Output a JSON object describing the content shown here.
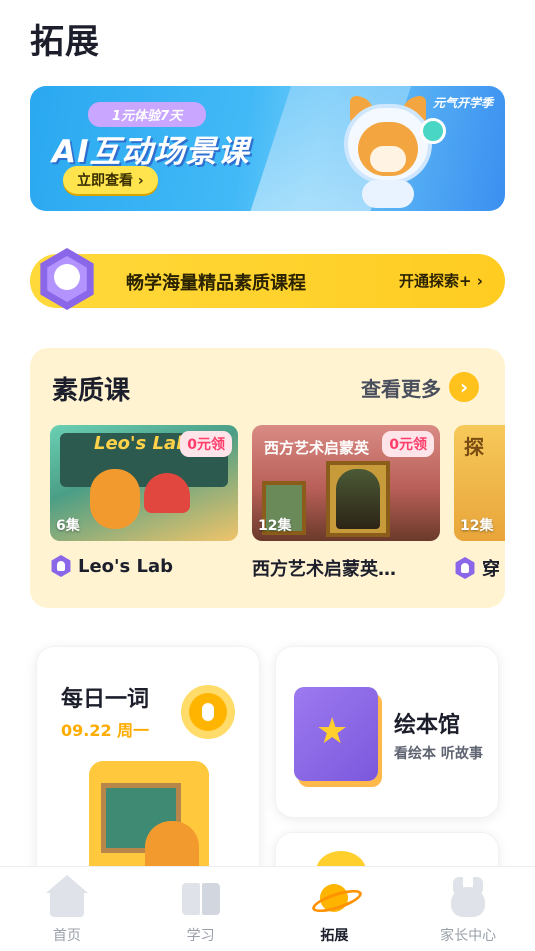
{
  "page": {
    "title": "拓展"
  },
  "banner": {
    "trial": "1元体验7天",
    "title": "AI互动场景课",
    "cta": "立即查看 ›",
    "badge": "元气开学季",
    "slides": 3,
    "active_slide": 1
  },
  "vip": {
    "text": "畅学海量精品素质课程",
    "action": "开通探索+ ›"
  },
  "quality": {
    "title": "素质课",
    "see_more": "查看更多",
    "see_more_arrow": "›",
    "courses": [
      {
        "name": "Leo's Lab",
        "episodes": "6集",
        "tag": "0元领",
        "thumb_text": "Leo's Lab"
      },
      {
        "name": "西方艺术启蒙英…",
        "episodes": "12集",
        "tag": "0元领",
        "thumb_text": "西方艺术启蒙英"
      },
      {
        "name": "穿",
        "episodes": "12集",
        "thumb_text": "探"
      }
    ]
  },
  "daily_word": {
    "title": "每日一词",
    "date": "09.22 周一"
  },
  "picture_book": {
    "title": "绘本馆",
    "subtitle": "看绘本 听故事",
    "star": "★"
  },
  "tabbar": {
    "tabs": [
      {
        "label": "首页",
        "icon": "home-icon"
      },
      {
        "label": "学习",
        "icon": "book-icon"
      },
      {
        "label": "拓展",
        "icon": "planet-icon",
        "active": true
      },
      {
        "label": "家长中心",
        "icon": "parent-icon"
      }
    ]
  },
  "colors": {
    "accent": "#ffc21c",
    "section_bg": "#fff3d2",
    "free_tag": "#ff3d6a",
    "date": "#ffac00",
    "brand_purple": "#8a66e8"
  }
}
